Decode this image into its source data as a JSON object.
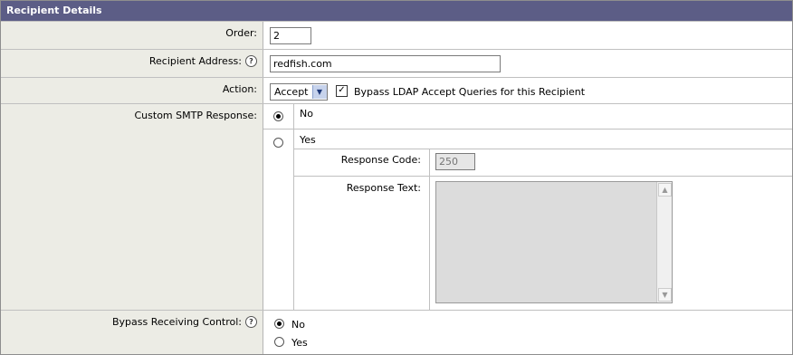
{
  "header": {
    "title": "Recipient Details"
  },
  "order": {
    "label": "Order:",
    "value": "2"
  },
  "recipient_address": {
    "label": "Recipient Address:",
    "value": "redfish.com"
  },
  "action": {
    "label": "Action:",
    "selected": "Accept",
    "bypass_label": "Bypass LDAP Accept Queries for this Recipient",
    "bypass_checked": true
  },
  "custom_smtp": {
    "label": "Custom SMTP Response:",
    "no_label": "No",
    "yes_label": "Yes",
    "selected": "No",
    "response_code_label": "Response Code:",
    "response_code_placeholder": "250",
    "response_text_label": "Response Text:"
  },
  "bypass_receiving": {
    "label": "Bypass Receiving Control:",
    "no_label": "No",
    "yes_label": "Yes",
    "selected": "No"
  },
  "icons": {
    "help": "help-icon",
    "dropdown": "chevron-down-icon",
    "checkbox": "check-icon"
  },
  "colors": {
    "header_bg": "#5c5d86",
    "label_bg": "#ecece5"
  }
}
